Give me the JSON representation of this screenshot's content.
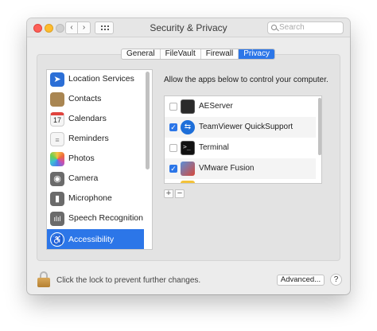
{
  "window": {
    "title": "Security & Privacy"
  },
  "search": {
    "placeholder": "Search"
  },
  "tabs": [
    {
      "label": "General",
      "active": false
    },
    {
      "label": "FileVault",
      "active": false
    },
    {
      "label": "Firewall",
      "active": false
    },
    {
      "label": "Privacy",
      "active": true
    }
  ],
  "sidebar": {
    "items": [
      {
        "label": "Location Services",
        "icon": "location-arrow-icon",
        "color": "#2c6fd6",
        "selected": false
      },
      {
        "label": "Contacts",
        "icon": "contacts-book-icon",
        "color": "#a98652",
        "selected": false
      },
      {
        "label": "Calendars",
        "icon": "calendar-icon",
        "color": "#f5f5f5",
        "selected": false
      },
      {
        "label": "Reminders",
        "icon": "reminders-list-icon",
        "color": "#f5f5f5",
        "selected": false
      },
      {
        "label": "Photos",
        "icon": "photos-flower-icon",
        "color": "#f5f5f5",
        "selected": false
      },
      {
        "label": "Camera",
        "icon": "camera-icon",
        "color": "#6b6b6b",
        "selected": false
      },
      {
        "label": "Microphone",
        "icon": "microphone-icon",
        "color": "#6b6b6b",
        "selected": false
      },
      {
        "label": "Speech Recognition",
        "icon": "waveform-icon",
        "color": "#6b6b6b",
        "selected": false
      },
      {
        "label": "Accessibility",
        "icon": "accessibility-person-icon",
        "color": "#2c76e8",
        "selected": true
      }
    ]
  },
  "apps": {
    "heading": "Allow the apps below to control your computer.",
    "items": [
      {
        "name": "AEServer",
        "checked": false,
        "icon": "terminal-app-icon"
      },
      {
        "name": "TeamViewer QuickSupport",
        "checked": true,
        "icon": "teamviewer-icon"
      },
      {
        "name": "Terminal",
        "checked": false,
        "icon": "terminal-app-icon"
      },
      {
        "name": "VMware Fusion",
        "checked": true,
        "icon": "vmware-fusion-icon"
      }
    ],
    "add_label": "+",
    "remove_label": "−"
  },
  "footer": {
    "lock_text": "Click the lock to prevent further changes.",
    "advanced_label": "Advanced...",
    "help_label": "?"
  },
  "colors": {
    "accent": "#2c76e8"
  }
}
